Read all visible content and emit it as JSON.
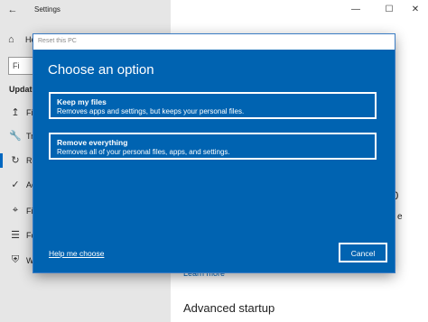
{
  "window": {
    "title": "Settings",
    "back_icon": "←",
    "minimize": "—",
    "maximize": "☐",
    "close": "✕"
  },
  "sidebar": {
    "home_label": "He",
    "search_placeholder": "Fi",
    "section_label": "Update",
    "items": [
      {
        "icon": "↥",
        "label": "Fil"
      },
      {
        "icon": "🔧",
        "label": "Tro"
      },
      {
        "icon": "↻",
        "label": "Re"
      },
      {
        "icon": "✓",
        "label": "Ac"
      },
      {
        "icon": "⌖",
        "label": "Fin"
      },
      {
        "icon": "☰",
        "label": "Fo"
      },
      {
        "icon": "⛨",
        "label": "Wi"
      }
    ]
  },
  "main": {
    "fragments": [
      "R",
      "10",
      "e"
    ],
    "learn_more": "Learn more",
    "advanced_startup": "Advanced startup"
  },
  "dialog": {
    "title": "Reset this PC",
    "heading": "Choose an option",
    "options": [
      {
        "title": "Keep my files",
        "description": "Removes apps and settings, but keeps your personal files."
      },
      {
        "title": "Remove everything",
        "description": "Removes all of your personal files, apps, and settings."
      }
    ],
    "help_link": "Help me choose",
    "cancel_label": "Cancel"
  },
  "colors": {
    "dialog_background": "#0063b1",
    "sidebar_background": "#e6e6e6",
    "accent": "#0067c0"
  }
}
